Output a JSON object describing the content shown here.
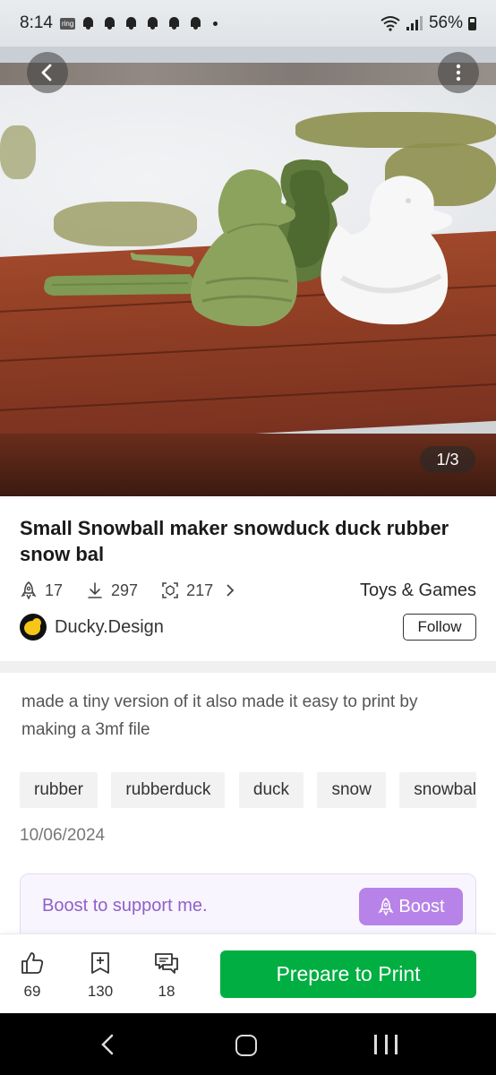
{
  "status_bar": {
    "time": "8:14",
    "ring_badge": "ring",
    "battery": "56%"
  },
  "gallery": {
    "page_indicator": "1/3",
    "current_image": 1,
    "total_images": 3
  },
  "model": {
    "title": "Small Snowball maker snowduck duck rubber snow bal",
    "boosts": "17",
    "downloads": "297",
    "prints": "217",
    "category": "Toys & Games"
  },
  "author": {
    "name": "Ducky.Design",
    "follow_label": "Follow"
  },
  "description": "made a tiny version of it also made it easy to print by making a 3mf file",
  "tags": [
    "rubber",
    "rubberduck",
    "duck",
    "snow",
    "snowball"
  ],
  "date": "10/06/2024",
  "boost_card": {
    "text": "Boost to support me.",
    "button_label": "Boost"
  },
  "bottom_bar": {
    "likes": "69",
    "collects": "130",
    "comments": "18",
    "prepare_label": "Prepare to Print"
  },
  "colors": {
    "primary_green": "#00ae42",
    "boost_purple": "#b883e8",
    "boost_text": "#9060c8"
  }
}
